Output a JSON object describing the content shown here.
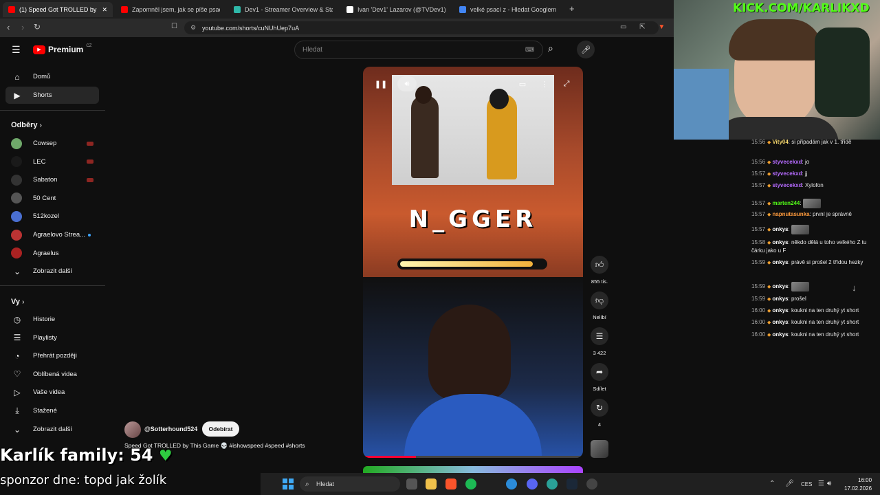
{
  "browser": {
    "tabs": [
      {
        "label": "(1) Speed Got TROLLED by Th",
        "color": "#ff0000",
        "active": true
      },
      {
        "label": "Zapomněl jsem, jak se píše psacím",
        "color": "#ff0000"
      },
      {
        "label": "Dev1 - Streamer Overview & Stats · T",
        "color": "#2fb8a9"
      },
      {
        "label": "Ivan 'Dev1' Lazarov (@TVDev1) / X",
        "color": "#ffffff"
      },
      {
        "label": "velké psací z - Hledat Googlem",
        "color": "#4285f4"
      }
    ],
    "new_tab": "+",
    "url": "youtube.com/shorts/cuNUhUep7uA"
  },
  "youtube": {
    "logo": "Premium",
    "logo_sup": "CZ",
    "search_placeholder": "Hledat",
    "nav": [
      {
        "label": "Domů",
        "icon": "home-icon"
      },
      {
        "label": "Shorts",
        "icon": "shorts-icon",
        "active": true
      }
    ],
    "subscriptions_title": "Odběry",
    "channels": [
      {
        "label": "Cowsep",
        "color": "#6fa86a",
        "live": true
      },
      {
        "label": "LEC",
        "color": "#1a1a1a",
        "live": true
      },
      {
        "label": "Sabaton",
        "color": "#333333",
        "live": true
      },
      {
        "label": "50 Cent",
        "color": "#555555"
      },
      {
        "label": "512kozel",
        "color": "#4a6fd1"
      },
      {
        "label": "Agraelovo Strea...",
        "color": "#b33",
        "dot": true
      },
      {
        "label": "Agraelus",
        "color": "#a22"
      }
    ],
    "show_more_1": "Zobrazit další",
    "you_title": "Vy",
    "you_items": [
      {
        "label": "Historie",
        "icon": "history-icon"
      },
      {
        "label": "Playlisty",
        "icon": "playlists-icon"
      },
      {
        "label": "Přehrát později",
        "icon": "watch-later-icon"
      },
      {
        "label": "Oblíbená videa",
        "icon": "like-icon"
      },
      {
        "label": "Vaše videa",
        "icon": "your-videos-icon"
      },
      {
        "label": "Stažené",
        "icon": "download-icon"
      }
    ],
    "show_more_2": "Zobrazit další"
  },
  "short": {
    "overlay_word": "N_GGER",
    "progress": 0.92,
    "channel": "@Sotterhound524",
    "subscribe_label": "Odebírat",
    "title": "Speed Got TROLLED by This Game 💀 #ishowspeed #speed #shorts",
    "like_count": "855 tis.",
    "dislike_label": "Nelíbí",
    "comments": "3 422",
    "share_label": "Sdílet",
    "remix_count": "4"
  },
  "stream": {
    "kick_url": "KICK.COM/KARLIKXD",
    "family_label": "Karlík family: 54",
    "sponsor": "sponzor dne: topd jak žolík"
  },
  "chat": [
    {
      "time": "15:56",
      "user": "Vity04",
      "msg": "si připadám jak v 1. třídě",
      "color": "#f5d76e"
    },
    {
      "time": "15:56",
      "user": "styvecekxd",
      "msg": "jo",
      "color": "#b66bff"
    },
    {
      "time": "15:57",
      "user": "styvecekxd",
      "msg": "jj",
      "color": "#b66bff"
    },
    {
      "time": "15:57",
      "user": "styvecekxd",
      "msg": "Xylofon",
      "color": "#b66bff"
    },
    {
      "time": "15:57",
      "user": "marten244",
      "msg": "",
      "color": "#53fc18"
    },
    {
      "time": "15:57",
      "user": "napnutasunka",
      "msg": "první je správně",
      "color": "#ff9b3d"
    },
    {
      "time": "15:57",
      "user": "onkys",
      "msg": "",
      "color": "#ffffff"
    },
    {
      "time": "15:58",
      "user": "onkys",
      "msg": "někdo dělá u toho velkého Z tu čárku jako u F",
      "color": "#ffffff"
    },
    {
      "time": "15:59",
      "user": "onkys",
      "msg": "právě si prošel 2 třídou hezky",
      "color": "#ffffff"
    },
    {
      "time": "15:59",
      "user": "onkys",
      "msg": "",
      "color": "#ffffff"
    },
    {
      "time": "15:59",
      "user": "onkys",
      "msg": "prošel",
      "color": "#ffffff"
    },
    {
      "time": "16:00",
      "user": "onkys",
      "msg": "koukni na ten druhý yt short",
      "color": "#ffffff"
    },
    {
      "time": "16:00",
      "user": "onkys",
      "msg": "koukni na ten druhý yt short",
      "color": "#ffffff"
    },
    {
      "time": "16:00",
      "user": "onkys",
      "msg": "koukni na ten druhý yt short",
      "color": "#ffffff"
    }
  ],
  "taskbar": {
    "search": "Hledat",
    "lang": "CES",
    "time": "16:00",
    "date": "17.02.2026"
  }
}
